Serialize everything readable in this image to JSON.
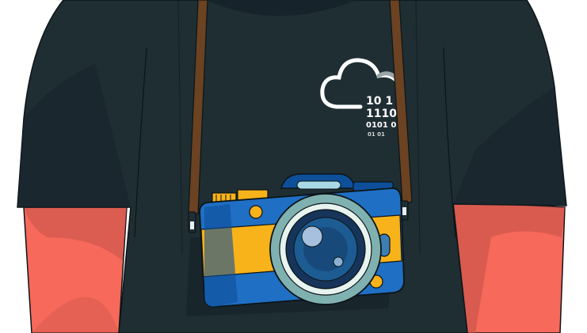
{
  "scene": {
    "description_label": "",
    "colors": {
      "background": "#ffffff",
      "shirt": "#1f2e33",
      "shirt_shadow": "#16232a",
      "skin": "#f7695a",
      "skin_shadow": "#c4524a",
      "strap": "#6b4222",
      "camera_blue": "#1f6fc4",
      "camera_dark_blue": "#0e4f9a",
      "camera_yellow": "#f8b21a",
      "lens_ring": "#7fb1b0",
      "lens_inner": "#1c5c92",
      "outline": "#0c1418"
    },
    "icons": {
      "shirt_print": "cloud-binary-icon",
      "camera": "camera-icon"
    },
    "shirt_print": {
      "lines": [
        "10 1",
        "1110",
        "0101 0",
        "01  01"
      ]
    }
  }
}
